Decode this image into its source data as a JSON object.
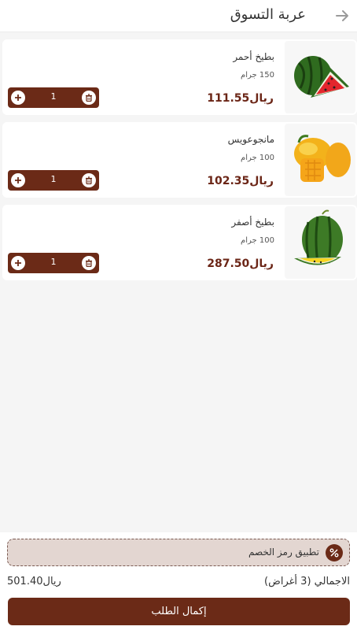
{
  "header": {
    "title": "عربة التسوق",
    "back_icon": "arrow-right-icon"
  },
  "cart": {
    "items": [
      {
        "name": "بطيخ أحمر",
        "weight": "150 جرام",
        "price": "ريال111.55",
        "quantity": "1",
        "image": "watermelon-red"
      },
      {
        "name": "مانجوعويس",
        "weight": "100 جرام",
        "price": "ريال102.35",
        "quantity": "1",
        "image": "mango"
      },
      {
        "name": "بطيخ أصفر",
        "weight": "100 جرام",
        "price": "ريال287.50",
        "quantity": "1",
        "image": "watermelon-yellow"
      }
    ]
  },
  "footer": {
    "coupon_label": "تطبيق رمز الخصم",
    "coupon_icon": "percent-icon",
    "total_label": "الاجمالي (3 أغراض)",
    "total_value": "ريال501.40",
    "checkout_label": "إكمال الطلب"
  },
  "colors": {
    "accent": "#6b2a17",
    "price": "#6b2516",
    "coupon_bg": "#e3d6d1",
    "background": "#f5f5f5"
  }
}
